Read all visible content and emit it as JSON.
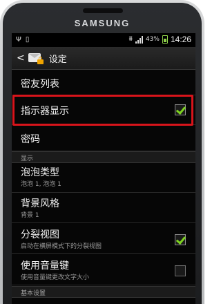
{
  "device": {
    "brand": "SAMSUNG"
  },
  "statusbar": {
    "battery_percent": "43%",
    "time": "14:26"
  },
  "actionbar": {
    "back": "<",
    "title": "设定"
  },
  "items": [
    {
      "label": "密友列表"
    },
    {
      "label": "指示器显示",
      "checked": true
    },
    {
      "label": "密码"
    }
  ],
  "section_display": "显示",
  "display_items": [
    {
      "label": "泡泡类型",
      "sub": "泡泡 1, 泡泡 1"
    },
    {
      "label": "背景风格",
      "sub": "背景 1"
    },
    {
      "label": "分裂视图",
      "sub": "启动在横屏模式下的分裂视图",
      "checked": true
    },
    {
      "label": "使用音量键",
      "sub": "使用音量键更改文字大小",
      "checked": false
    }
  ],
  "section_basic": "基本设置",
  "colors": {
    "highlight": "#d8141b",
    "check": "#7ed321"
  }
}
